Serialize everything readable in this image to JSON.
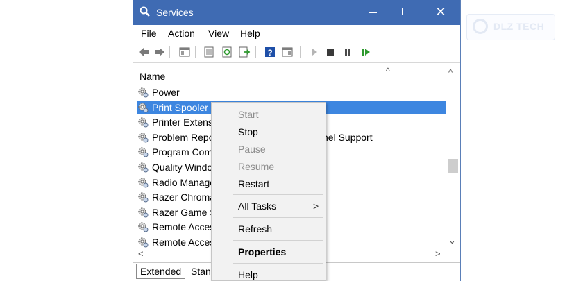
{
  "window": {
    "title": "Services",
    "minimize": "",
    "maximize": "",
    "close": "✕"
  },
  "menubar": [
    "File",
    "Action",
    "View",
    "Help"
  ],
  "toolbar": {
    "icons": [
      "back-arrow-icon",
      "forward-arrow-icon",
      "show-hide-console-tree-icon",
      "properties-icon",
      "refresh-icon",
      "export-list-icon",
      "help-icon",
      "show-action-pane-icon",
      "start-service-icon",
      "stop-service-icon",
      "pause-service-icon",
      "restart-service-icon"
    ]
  },
  "list": {
    "column_name": "Name",
    "sort_indicator": "^",
    "rows": [
      {
        "label": "Power",
        "desc": ""
      },
      {
        "label": "Print Spooler",
        "desc": ""
      },
      {
        "label": "Printer Extensi",
        "desc": ""
      },
      {
        "label": "Problem Repo",
        "desc": "nel Support"
      },
      {
        "label": "Program Com",
        "desc": ""
      },
      {
        "label": "Quality Windo",
        "desc": ""
      },
      {
        "label": "Radio Manage",
        "desc": ""
      },
      {
        "label": "Razer Chroma",
        "desc": ""
      },
      {
        "label": "Razer Game Sc",
        "desc": ""
      },
      {
        "label": "Remote Acces",
        "desc": ""
      },
      {
        "label": "Remote Acces",
        "desc": ""
      }
    ],
    "selected_index": 1
  },
  "scroll": {
    "up": "^",
    "down": "⌄",
    "left": "<",
    "right": ">"
  },
  "tabs": {
    "extended": "Extended",
    "standard": "Stan"
  },
  "context_menu": {
    "start": "Start",
    "stop": "Stop",
    "pause": "Pause",
    "resume": "Resume",
    "restart": "Restart",
    "all_tasks": "All Tasks",
    "submenu_arrow": ">",
    "refresh": "Refresh",
    "properties": "Properties",
    "help": "Help"
  },
  "watermark": {
    "text": "DLZ TECH"
  },
  "colors": {
    "titlebar": "#3f6bb3",
    "selection": "#3d86e0"
  }
}
